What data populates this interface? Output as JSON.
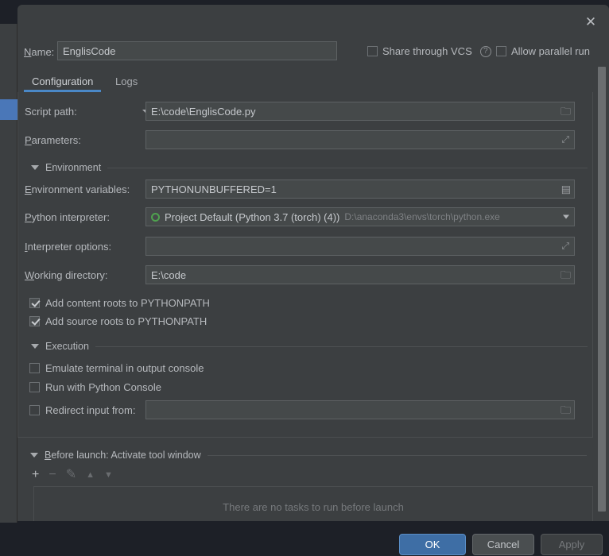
{
  "window": {
    "close_label": "✕"
  },
  "name_row": {
    "label": "Name:",
    "value": "EnglisCode",
    "share_vcs_label": "Share through VCS",
    "share_vcs_checked": false,
    "help_label": "?",
    "allow_parallel_label": "Allow parallel run",
    "allow_parallel_checked": false
  },
  "tabs": [
    {
      "label": "Configuration",
      "active": true
    },
    {
      "label": "Logs",
      "active": false
    }
  ],
  "form": {
    "script_path": {
      "label": "Script path:",
      "value": "E:\\code\\EnglisCode.py",
      "icon": "folder-icon"
    },
    "parameters": {
      "label": "Parameters:",
      "value": "",
      "icon": "expand-icon"
    },
    "environment_section": "Environment",
    "environment_variables": {
      "label": "Environment variables:",
      "value": "PYTHONUNBUFFERED=1",
      "icon": "list-icon"
    },
    "python_interpreter": {
      "label": "Python interpreter:",
      "value": "Project Default (Python 3.7 (torch) (4))",
      "path": "D:\\anaconda3\\envs\\torch\\python.exe",
      "icon": "chevron-down-icon",
      "status_color": "#4fa24f"
    },
    "interpreter_options": {
      "label": "Interpreter options:",
      "value": "",
      "icon": "expand-icon"
    },
    "working_directory": {
      "label": "Working directory:",
      "value": "E:\\code",
      "icon": "folder-icon"
    },
    "add_content_roots": {
      "label": "Add content roots to PYTHONPATH",
      "checked": true
    },
    "add_source_roots": {
      "label": "Add source roots to PYTHONPATH",
      "checked": true
    },
    "execution_section": "Execution",
    "emulate_terminal": {
      "label": "Emulate terminal in output console",
      "checked": false
    },
    "run_with_console": {
      "label": "Run with Python Console",
      "checked": false
    },
    "redirect_input": {
      "label": "Redirect input from:",
      "checked": false,
      "value": "",
      "icon": "folder-icon"
    }
  },
  "before_launch": {
    "title": "Before launch: Activate tool window",
    "toolbar": {
      "add": "+",
      "remove": "−",
      "edit": "✎",
      "up": "▲",
      "down": "▼"
    },
    "empty_message": "There are no tasks to run before launch"
  },
  "footer": {
    "ok": "OK",
    "cancel": "Cancel",
    "apply": "Apply"
  },
  "colors": {
    "accent": "#4a88c7",
    "dialog_bg": "#3c3f41",
    "field_bg": "#45494a",
    "ok_button": "#3e6ea5"
  }
}
